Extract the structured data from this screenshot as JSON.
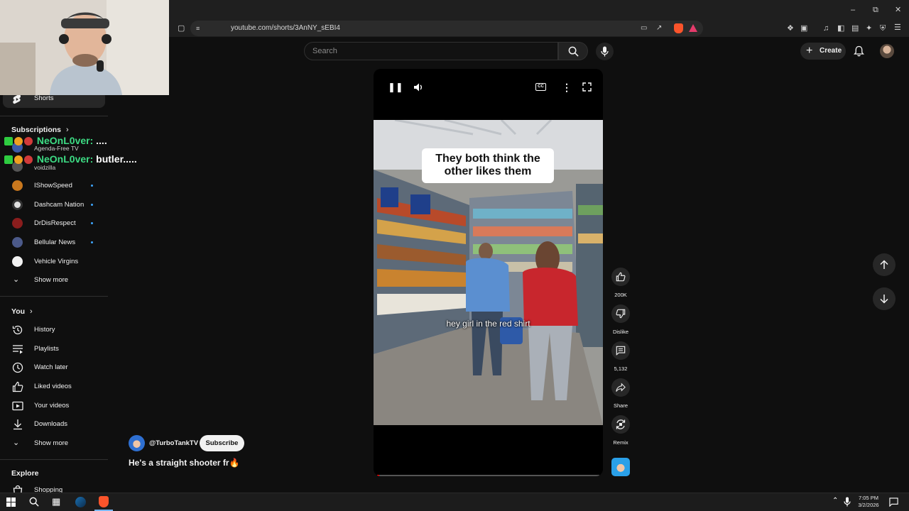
{
  "browser": {
    "url": "youtube.com/shorts/3AnNY_sEBI4"
  },
  "header": {
    "search_placeholder": "Search",
    "create_label": "Create"
  },
  "sidebar": {
    "shorts_label": "Shorts",
    "subscriptions_title": "Subscriptions",
    "subscriptions": [
      {
        "name": "Agenda-Free TV",
        "color": "#3b5aa8"
      },
      {
        "name": "voidzilla",
        "color": "#555555"
      },
      {
        "name": "IShowSpeed",
        "color": "#c9781e",
        "dot": true
      },
      {
        "name": "Dashcam Nation",
        "color": "#e0e0e0",
        "dot": true
      },
      {
        "name": "DrDisRespect",
        "color": "#8a1d1d",
        "dot": true
      },
      {
        "name": "Bellular News",
        "color": "#4c5a8a",
        "dot": true
      },
      {
        "name": "Vehicle Virgins",
        "color": "#f2f2f2"
      }
    ],
    "show_more_1": "Show more",
    "you_title": "You",
    "you_items": [
      {
        "label": "History",
        "icon": "history-icon"
      },
      {
        "label": "Playlists",
        "icon": "playlists-icon"
      },
      {
        "label": "Watch later",
        "icon": "watch-later-icon"
      },
      {
        "label": "Liked videos",
        "icon": "liked-videos-icon"
      },
      {
        "label": "Your videos",
        "icon": "your-videos-icon"
      },
      {
        "label": "Downloads",
        "icon": "downloads-icon"
      }
    ],
    "show_more_2": "Show more",
    "explore_title": "Explore",
    "shopping_label": "Shopping"
  },
  "chat": [
    {
      "user": "NeOnL0ver",
      "message": "....",
      "user_color": "#3ddc84"
    },
    {
      "user": "NeOnL0ver",
      "message": "butler.....",
      "user_color": "#3ddc84"
    }
  ],
  "video": {
    "caption_text": "They both think the other likes them",
    "subtitle": "hey girl in the red shirt",
    "progress": 0.01
  },
  "actions": {
    "likes": "200K",
    "dislike_label": "Dislike",
    "comments": "5,132",
    "share_label": "Share",
    "remix_label": "Remix"
  },
  "channel": {
    "handle": "@TurboTankTV",
    "subscribe_label": "Subscribe",
    "video_title": "He's a straight shooter fr🔥"
  },
  "taskbar": {
    "time": "7:05 PM",
    "date": "3/2/2026"
  }
}
